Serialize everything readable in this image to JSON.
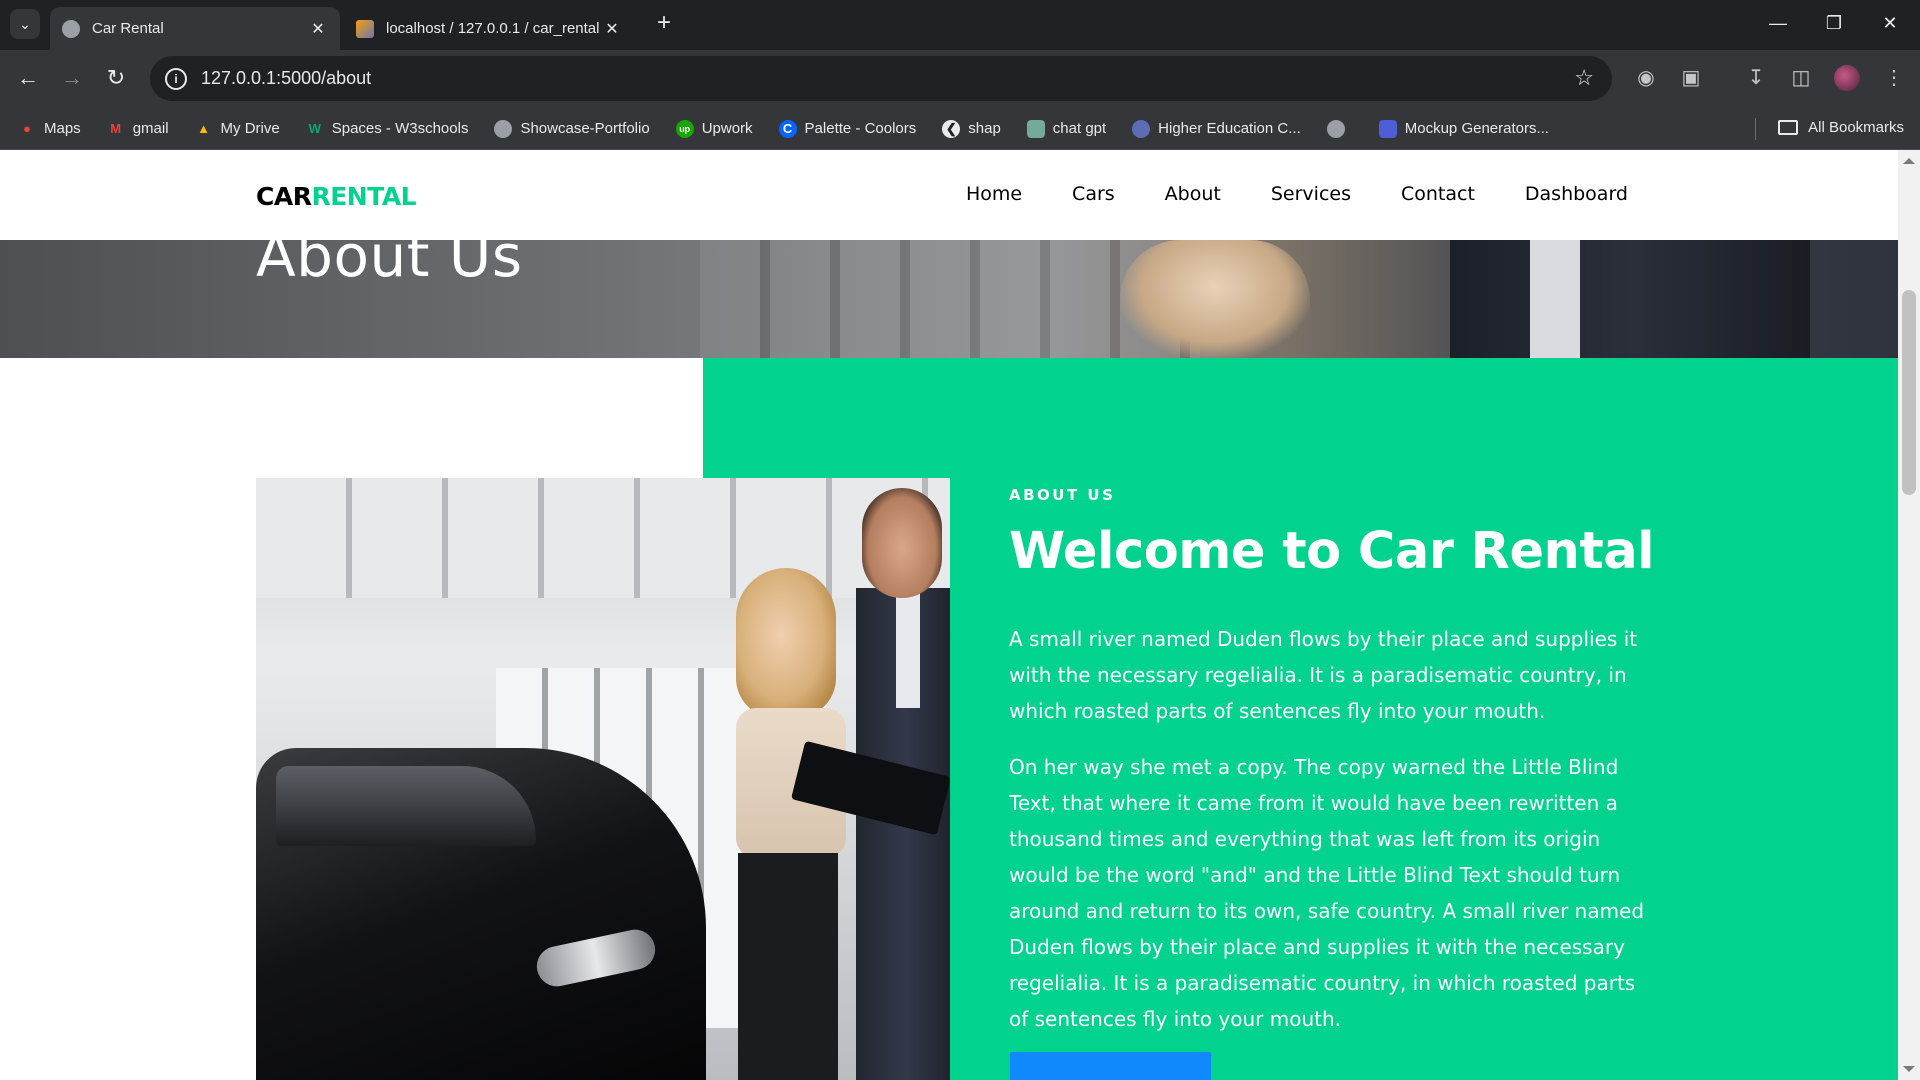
{
  "browser": {
    "tabs": [
      {
        "title": "Car Rental",
        "active": true
      },
      {
        "title": "localhost / 127.0.0.1 / car_rental",
        "active": false
      }
    ],
    "url": "127.0.0.1:5000/about",
    "bookmarks": [
      {
        "label": "Maps",
        "icon": "maps-pin-icon"
      },
      {
        "label": "gmail",
        "icon": "gmail-icon"
      },
      {
        "label": "My Drive",
        "icon": "drive-icon"
      },
      {
        "label": "Spaces - W3schools",
        "icon": "w3schools-icon"
      },
      {
        "label": "Showcase-Portfolio",
        "icon": "globe-icon"
      },
      {
        "label": "Upwork",
        "icon": "upwork-icon"
      },
      {
        "label": "Palette - Coolors",
        "icon": "coolors-icon"
      },
      {
        "label": "shap",
        "icon": "shap-icon"
      },
      {
        "label": "chat gpt",
        "icon": "chatgpt-icon"
      },
      {
        "label": "Higher Education C...",
        "icon": "education-icon"
      },
      {
        "label": "Mockup Generators...",
        "icon": "mockup-icon"
      }
    ],
    "all_bookmarks": "All Bookmarks"
  },
  "site": {
    "brand_part1": "CAR",
    "brand_part2": "RENTAL",
    "nav": [
      "Home",
      "Cars",
      "About",
      "Services",
      "Contact",
      "Dashboard"
    ],
    "hero_title": "About Us",
    "about": {
      "eyebrow": "ABOUT US",
      "heading": "Welcome to Car Rental",
      "paragraph1": "A small river named Duden flows by their place and supplies it with the necessary regelialia. It is a paradisematic country, in which roasted parts of sentences fly into your mouth.",
      "paragraph2": "On her way she met a copy. The copy warned the Little Blind Text, that where it came from it would have been rewritten a thousand times and everything that was left from its origin would be the word \"and\" and the Little Blind Text should turn around and return to its own, safe country. A small river named Duden flows by their place and supplies it with the necessary regelialia. It is a paradisematic country, in which roasted parts of sentences fly into your mouth."
    }
  },
  "colors": {
    "brand_green": "#01d28e",
    "cta_blue": "#1089ff",
    "browser_dark": "#202124",
    "browser_toolbar": "#35363a"
  }
}
